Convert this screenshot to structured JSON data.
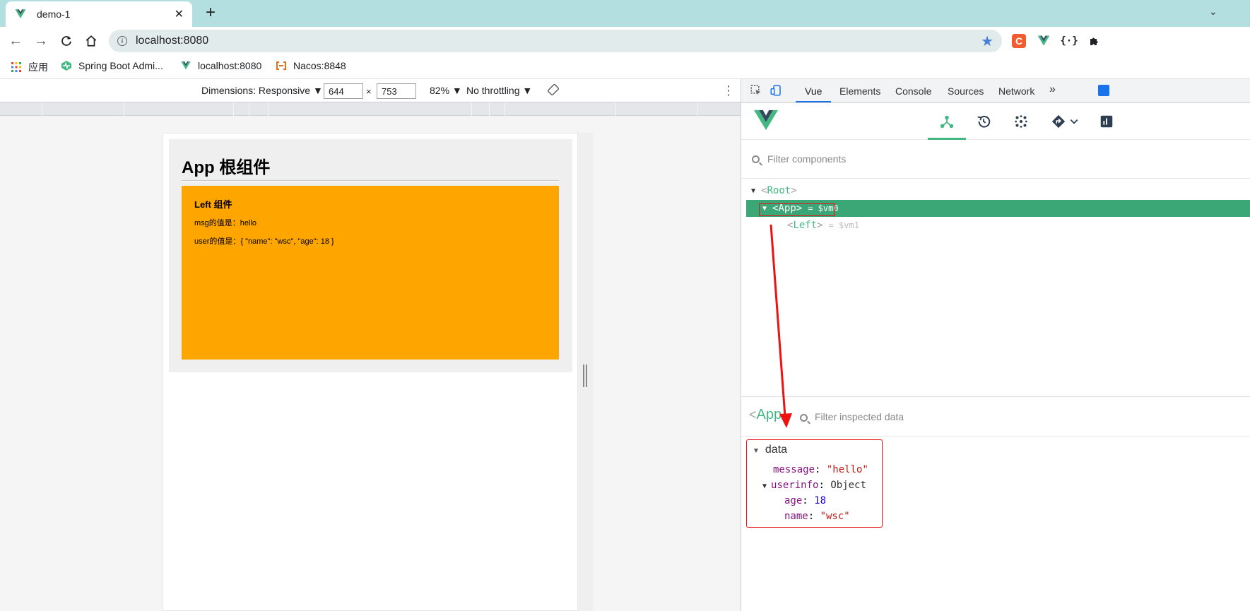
{
  "browser": {
    "tab_title": "demo-1",
    "url": "localhost:8080",
    "bookmarks": [
      {
        "label": "应用"
      },
      {
        "label": "Spring Boot Admi..."
      },
      {
        "label": "localhost:8080"
      },
      {
        "label": "Nacos:8848"
      }
    ]
  },
  "device_toolbar": {
    "dimensions_label": "Dimensions: Responsive ▼",
    "width": "644",
    "times": "×",
    "height": "753",
    "zoom": "82% ▼",
    "throttling": "No throttling ▼"
  },
  "page": {
    "app_title": "App 根组件",
    "left_title": "Left 组件",
    "msg_line": "msg的值是：hello",
    "user_line": "user的值是：{ \"name\": \"wsc\", \"age\": 18 }"
  },
  "devtools": {
    "tabs": [
      "Vue",
      "Elements",
      "Console",
      "Sources",
      "Network"
    ],
    "more": "»",
    "filter_components_placeholder": "Filter components",
    "tree": {
      "root": "Root",
      "app": "App",
      "app_vm": "= $vm0",
      "left": "Left",
      "left_vm": "= $vm1"
    },
    "inspected": {
      "name": "App",
      "filter_placeholder": "Filter inspected data",
      "section": "data",
      "message_key": "message",
      "message_val": "\"hello\"",
      "userinfo_key": "userinfo",
      "userinfo_val": "Object",
      "age_key": "age",
      "age_val": "18",
      "name_key": "name",
      "name_val": "\"wsc\""
    }
  },
  "colors": {
    "tab_bar": "#b4dfe0",
    "vue_green": "#42b883",
    "selected_row": "#3ba776",
    "component_bg": "#ffa500",
    "annotation_red": "#ee1111"
  }
}
